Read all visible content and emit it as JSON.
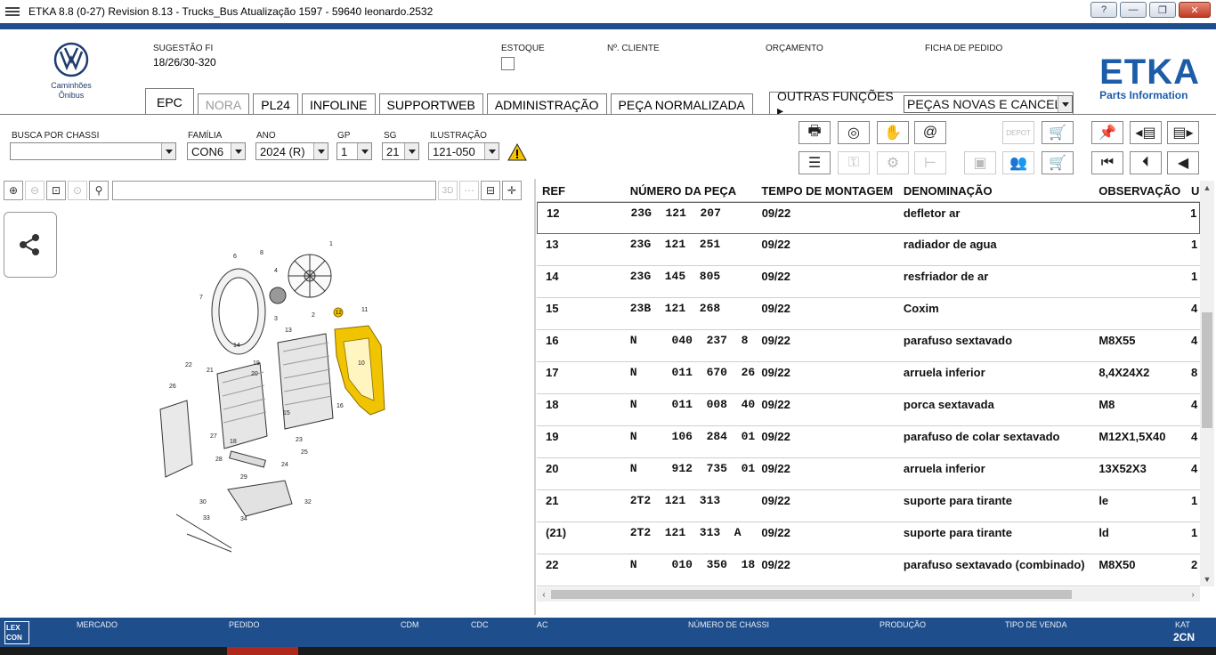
{
  "window": {
    "title": "ETKA 8.8 (0-27) Revision 8.13 - Trucks_Bus Atualização 1597 - 59640 leonardo.2532",
    "buttons": [
      "?",
      "—",
      "❐",
      "✕"
    ]
  },
  "header": {
    "logo_sub": "Caminhões\nÔnibus",
    "sugestao_label": "SUGESTÃO FI",
    "sugestao_value": "18/26/30-320",
    "estoque_label": "ESTOQUE",
    "cliente_label": "Nº. CLIENTE",
    "orcamento_label": "ORÇAMENTO",
    "ficha_label": "FICHA DE PEDIDO",
    "etka_logo": "ETKA",
    "etka_sub": "Parts Information"
  },
  "tabs": [
    {
      "label": "EPC",
      "active": true
    },
    {
      "label": "NORA",
      "disabled": true
    },
    {
      "label": "PL24"
    },
    {
      "label": "INFOLINE"
    },
    {
      "label": "SUPPORTWEB"
    },
    {
      "label": "ADMINISTRAÇÃO"
    },
    {
      "label": "PEÇA NORMALIZADA"
    }
  ],
  "other_functions": {
    "label": "OUTRAS FUNÇÕES",
    "selected": "PEÇAS NOVAS E CANCEL."
  },
  "filters": {
    "busca_label": "BUSCA POR CHASSI",
    "busca_value": "",
    "familia_label": "FAMÍLIA",
    "familia_value": "CON6",
    "ano_label": "ANO",
    "ano_value": "2024 (R)",
    "gp_label": "GP",
    "gp_value": "1",
    "sg_label": "SG",
    "sg_value": "21",
    "ilustracao_label": "ILUSTRAÇÃO",
    "ilustracao_value": "121-050"
  },
  "toolbar_right": {
    "depot_label": "DEPOT"
  },
  "left_toolbar": {
    "btn_3d": "3D"
  },
  "table": {
    "columns": [
      "REF",
      "NÚMERO DA PEÇA",
      "TEMPO DE MONTAGEM",
      "DENOMINAÇÃO",
      "OBSERVAÇÃO",
      "U"
    ],
    "rows": [
      {
        "ref": "12",
        "part": "23G  121  207",
        "time": "09/22",
        "den": "defletor ar",
        "obs": "",
        "u": "1",
        "selected": true
      },
      {
        "ref": "13",
        "part": "23G  121  251",
        "time": "09/22",
        "den": "radiador de agua",
        "obs": "",
        "u": "1"
      },
      {
        "ref": "14",
        "part": "23G  145  805",
        "time": "09/22",
        "den": "resfriador de ar",
        "obs": "",
        "u": "1"
      },
      {
        "ref": "15",
        "part": "23B  121  268",
        "time": "09/22",
        "den": "Coxim",
        "obs": "",
        "u": "4"
      },
      {
        "ref": "16",
        "part": "N     040  237  8",
        "time": "09/22",
        "den": "parafuso sextavado",
        "obs": "M8X55",
        "u": "4"
      },
      {
        "ref": "17",
        "part": "N     011  670  26",
        "time": "09/22",
        "den": "arruela inferior",
        "obs": "8,4X24X2",
        "u": "8"
      },
      {
        "ref": "18",
        "part": "N     011  008  40",
        "time": "09/22",
        "den": "porca sextavada",
        "obs": "M8",
        "u": "4"
      },
      {
        "ref": "19",
        "part": "N     106  284  01",
        "time": "09/22",
        "den": "parafuso de colar sextavado",
        "obs": "M12X1,5X40",
        "u": "4"
      },
      {
        "ref": "20",
        "part": "N     912  735  01",
        "time": "09/22",
        "den": "arruela inferior",
        "obs": "13X52X3",
        "u": "4"
      },
      {
        "ref": "21",
        "part": "2T2  121  313",
        "time": "09/22",
        "den": "suporte para tirante",
        "obs": "le",
        "u": "1"
      },
      {
        "ref": "(21)",
        "part": "2T2  121  313  A",
        "time": "09/22",
        "den": "suporte para tirante",
        "obs": "ld",
        "u": "1"
      },
      {
        "ref": "22",
        "part": "N     010  350  18",
        "time": "09/22",
        "den": "parafuso sextavado (combinado)",
        "obs": "M8X50",
        "u": "2"
      }
    ]
  },
  "statusbar": {
    "lexcon": "LEX\nCON",
    "fields": [
      "MERCADO",
      "PEDIDO",
      "CDM",
      "CDC",
      "AC",
      "NÚMERO DE CHASSI",
      "PRODUÇÃO",
      "TIPO DE VENDA",
      "KAT"
    ],
    "kat_value": "2CN"
  },
  "colors": {
    "brand_blue": "#1f4e8c",
    "highlight_yellow": "#f0c400"
  }
}
